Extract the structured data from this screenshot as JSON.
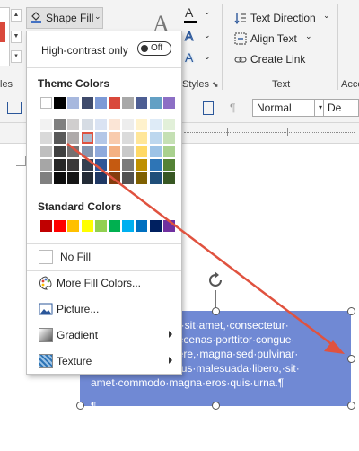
{
  "ribbon": {
    "shape_fill_label": "Shape Fill",
    "text_direction_label": "Text Direction",
    "align_text_label": "Align Text",
    "create_link_label": "Create Link",
    "group_styles_label": "les",
    "group_styles2_label": "Styles",
    "group_text_label": "Text",
    "group_acc_label": "Acce",
    "wordart_letter": "A"
  },
  "row2": {
    "style_value": "Normal",
    "font_value": "De",
    "para_mark": "¶"
  },
  "menu": {
    "high_contrast_label": "High-contrast only",
    "toggle_state": "Off",
    "theme_colors_title": "Theme Colors",
    "standard_colors_title": "Standard Colors",
    "no_fill_label": "No Fill",
    "more_fill_label": "More Fill Colors...",
    "picture_label": "Picture...",
    "gradient_label": "Gradient",
    "texture_label": "Texture"
  },
  "theme_colors": {
    "top": [
      "#ffffff",
      "#000000",
      "#e7e6e6",
      "#44546a",
      "#4472c4",
      "#ed7d31",
      "#a5a5a5",
      "#ffc000",
      "#5b9bd5",
      "#70ad47"
    ],
    "columns": [
      [
        "#f2f2f2",
        "#d9d9d9",
        "#bfbfbf",
        "#a6a6a6",
        "#808080"
      ],
      [
        "#7f7f7f",
        "#595959",
        "#404040",
        "#262626",
        "#0d0d0d"
      ],
      [
        "#d0cece",
        "#aeaaaa",
        "#757171",
        "#3a3838",
        "#161616"
      ],
      [
        "#d6dce4",
        "#adb9ca",
        "#8496b0",
        "#333f50",
        "#222a35"
      ],
      [
        "#dae3f3",
        "#b4c7e7",
        "#8faadc",
        "#2f5597",
        "#1f3864"
      ],
      [
        "#fbe5d6",
        "#f8cbad",
        "#f4b183",
        "#c55a11",
        "#843c0c"
      ],
      [
        "#ededed",
        "#dbdbdb",
        "#c9c9c9",
        "#7b7b7b",
        "#525252"
      ],
      [
        "#fff2cc",
        "#ffe699",
        "#ffd966",
        "#bf9000",
        "#7f6000"
      ],
      [
        "#deebf7",
        "#bdd7ee",
        "#9dc3e6",
        "#2e75b6",
        "#1f4e79"
      ],
      [
        "#e2f0d9",
        "#c5e0b4",
        "#a9d18e",
        "#548235",
        "#385723"
      ]
    ],
    "display_top": [
      "#ffffff",
      "#000000",
      "#a7b8de",
      "#3e4a6b",
      "#7d9ad6",
      "#d9483b",
      "#a8a8a8",
      "#4d5e93",
      "#63a0c4",
      "#8c6fc5",
      "#8a6fc6"
    ],
    "selected_index": "theme column 4, shade row 1"
  },
  "standard_colors": [
    "#c00000",
    "#ff0000",
    "#ffc000",
    "#ffff00",
    "#92d050",
    "#00b050",
    "#00b0f0",
    "#0070c0",
    "#002060",
    "#7030a0"
  ],
  "document": {
    "textbox_lines": [
      "or·sit·amet,·consectetur·",
      "aecenas·porttitor·congue·",
      "uere,·magna·sed·pulvinar·",
      "ultricies,·purus·lectus·malesuada·libero,·sit·",
      "amet·commodo·magna·eros·quis·urna.¶"
    ],
    "textbox_pilcrow": "¶",
    "textbox_color": "#7089d4"
  },
  "colors": {
    "accent_blue": "#2b579a",
    "arrow_red": "#e0523f"
  }
}
